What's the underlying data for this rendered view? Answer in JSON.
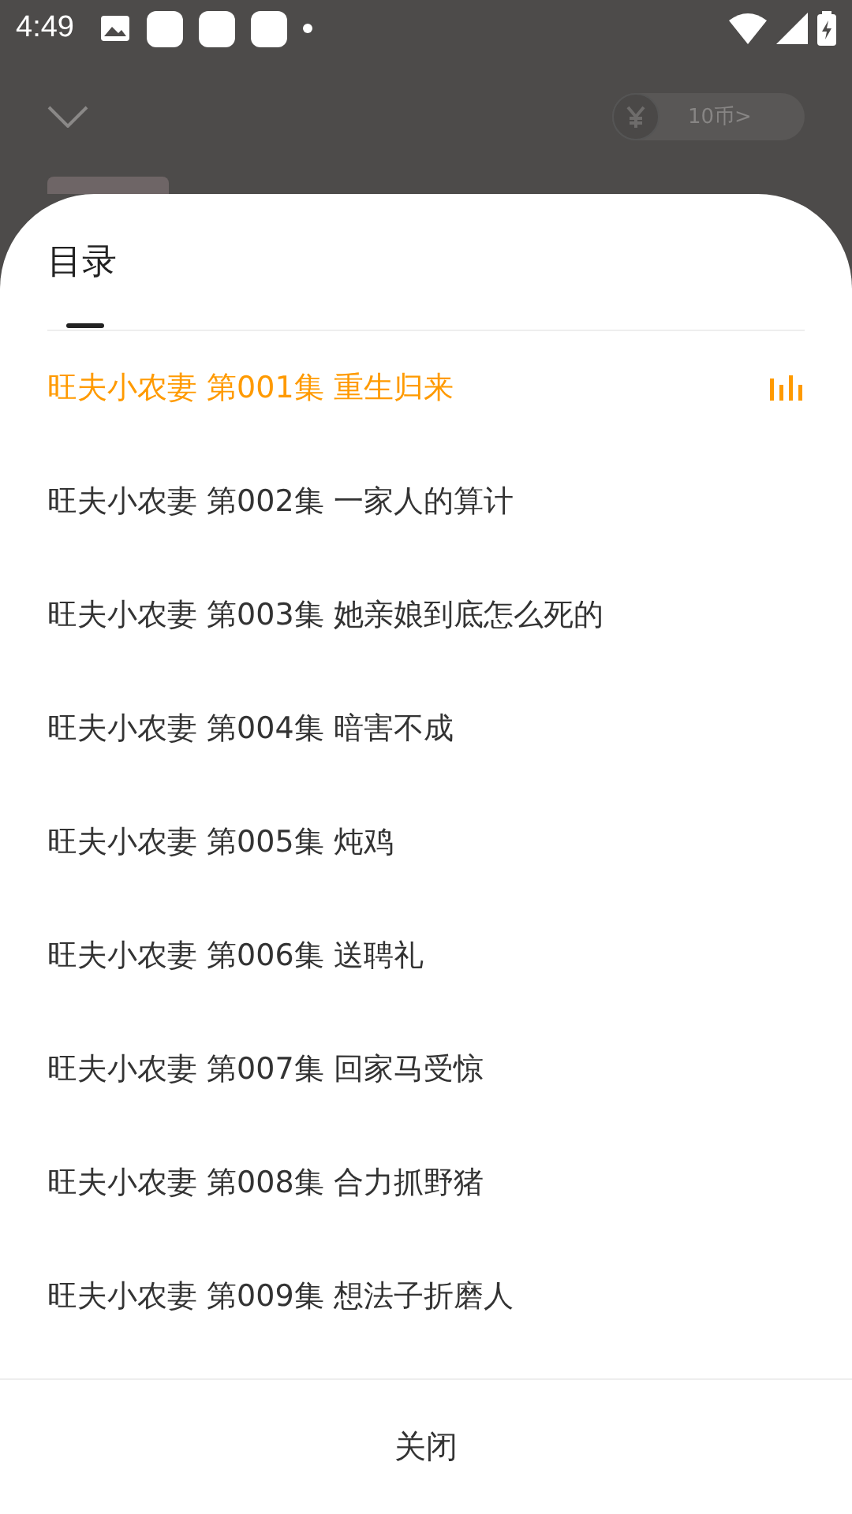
{
  "status_bar": {
    "time": "4:49"
  },
  "player": {
    "coin_badge": "10币>"
  },
  "sheet": {
    "title": "目录",
    "episodes": [
      {
        "label": "旺夫小农妻 第001集 重生归来",
        "selected": true
      },
      {
        "label": "旺夫小农妻 第002集 一家人的算计",
        "selected": false
      },
      {
        "label": "旺夫小农妻 第003集 她亲娘到底怎么死的",
        "selected": false
      },
      {
        "label": "旺夫小农妻 第004集 暗害不成",
        "selected": false
      },
      {
        "label": "旺夫小农妻 第005集 炖鸡",
        "selected": false
      },
      {
        "label": "旺夫小农妻 第006集 送聘礼",
        "selected": false
      },
      {
        "label": "旺夫小农妻 第007集 回家马受惊",
        "selected": false
      },
      {
        "label": "旺夫小农妻 第008集 合力抓野猪",
        "selected": false
      },
      {
        "label": "旺夫小农妻 第009集 想法子折磨人",
        "selected": false
      }
    ],
    "close_button": "关闭"
  }
}
